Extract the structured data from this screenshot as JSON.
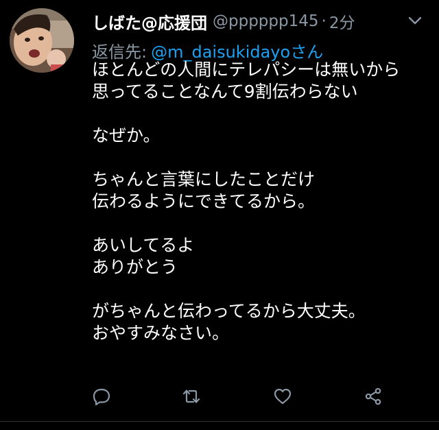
{
  "tweet": {
    "display_name": "しばた@応援団",
    "handle": "@pppppp145",
    "separator": "·",
    "time": "2分",
    "reply_label": "返信先:",
    "reply_handle": "@m_daisukidayoさん",
    "lines": [
      "ほとんどの人間にテレパシーは無いから",
      "思ってることなんて9割伝わらない",
      "",
      "なぜか。",
      "",
      "ちゃんと言葉にしたことだけ",
      "伝わるようにできてるから。",
      "",
      "あいしてるよ",
      "ありがとう",
      "",
      "がちゃんと伝わってるから大丈夫。",
      "おやすみなさい。"
    ]
  },
  "icons": {
    "menu": "chevron-down-icon",
    "reply": "reply-icon",
    "retweet": "retweet-icon",
    "like": "heart-icon",
    "share": "share-icon"
  },
  "colors": {
    "background": "#000000",
    "text": "#ffffff",
    "secondary": "#8b98a5",
    "link": "#1da1f2"
  }
}
